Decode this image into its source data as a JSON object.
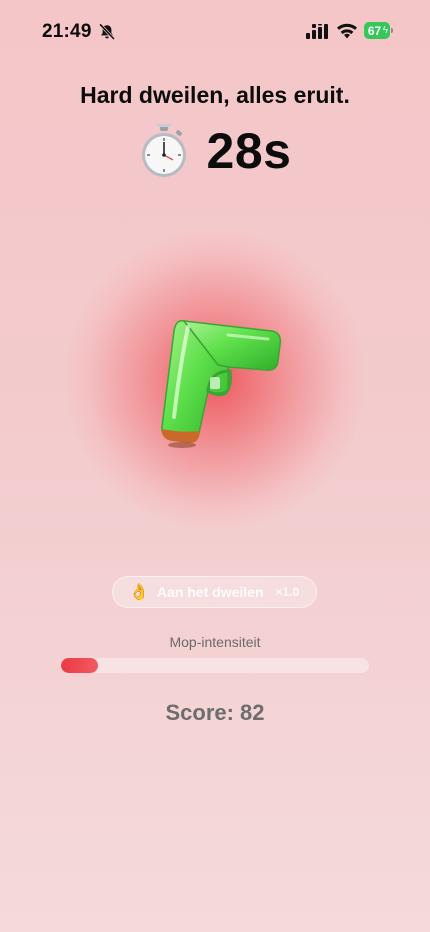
{
  "status_bar": {
    "time": "21:49",
    "battery_level": "67",
    "battery_color": "#34c759",
    "icons": [
      "bell-slash-icon",
      "cellular-signal-icon",
      "wifi-icon",
      "battery-icon"
    ]
  },
  "game": {
    "headline": "Hard dweilen, alles eruit.",
    "timer_icon": "stopwatch-icon",
    "timer": "28s",
    "center_icon": "water-pistol-icon",
    "glow_color": "#ec464c",
    "mode": {
      "emoji": "👌",
      "label": "Aan het dweilen",
      "multiplier": "×1.0"
    },
    "intensity": {
      "label": "Mop-intensiteit",
      "fraction": 0.12,
      "color": "#ea3a45"
    },
    "score": "Score: 82"
  }
}
